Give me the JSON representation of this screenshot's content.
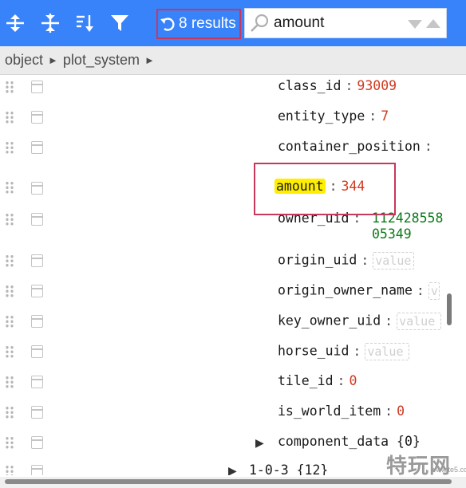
{
  "toolbar": {
    "buttons": [
      "expand-all",
      "collapse-all",
      "sort",
      "filter",
      "undo"
    ],
    "results_label": "8 results",
    "search": {
      "value": "amount",
      "placeholder": ""
    },
    "colors": {
      "bar": "#3883fa",
      "accent": "#c8375c"
    }
  },
  "breadcrumb": {
    "items": [
      "object",
      "plot_system"
    ],
    "separator": "►"
  },
  "tree": {
    "rows": [
      {
        "key": "class_id",
        "sep": ":",
        "value": "93009",
        "type": "number"
      },
      {
        "key": "entity_type",
        "sep": ":",
        "value": "7",
        "type": "number"
      },
      {
        "key": "container_position",
        "sep": ":",
        "value": "",
        "type": "truncated"
      },
      {
        "key": "amount",
        "sep": ":",
        "value": "344",
        "type": "number",
        "highlighted": true
      },
      {
        "key": "owner_uid",
        "sep": ":",
        "value_line1": "112428558",
        "value_line2": "05349",
        "type": "string"
      },
      {
        "key": "origin_uid",
        "sep": ":",
        "value": "value",
        "type": "empty"
      },
      {
        "key": "origin_owner_name",
        "sep": ":",
        "value": "v",
        "type": "empty"
      },
      {
        "key": "key_owner_uid",
        "sep": ":",
        "value": "value",
        "type": "empty"
      },
      {
        "key": "horse_uid",
        "sep": ":",
        "value": "value",
        "type": "empty"
      },
      {
        "key": "tile_id",
        "sep": ":",
        "value": "0",
        "type": "number"
      },
      {
        "key": "is_world_item",
        "sep": ":",
        "value": "0",
        "type": "number"
      },
      {
        "key": "component_data",
        "count": "{0}",
        "expander": "▶"
      },
      {
        "key": "1-0-3",
        "count": "{12}",
        "expander": "▶"
      }
    ]
  },
  "watermark": {
    "text": "特玩网",
    "small": "www.te5.com"
  }
}
